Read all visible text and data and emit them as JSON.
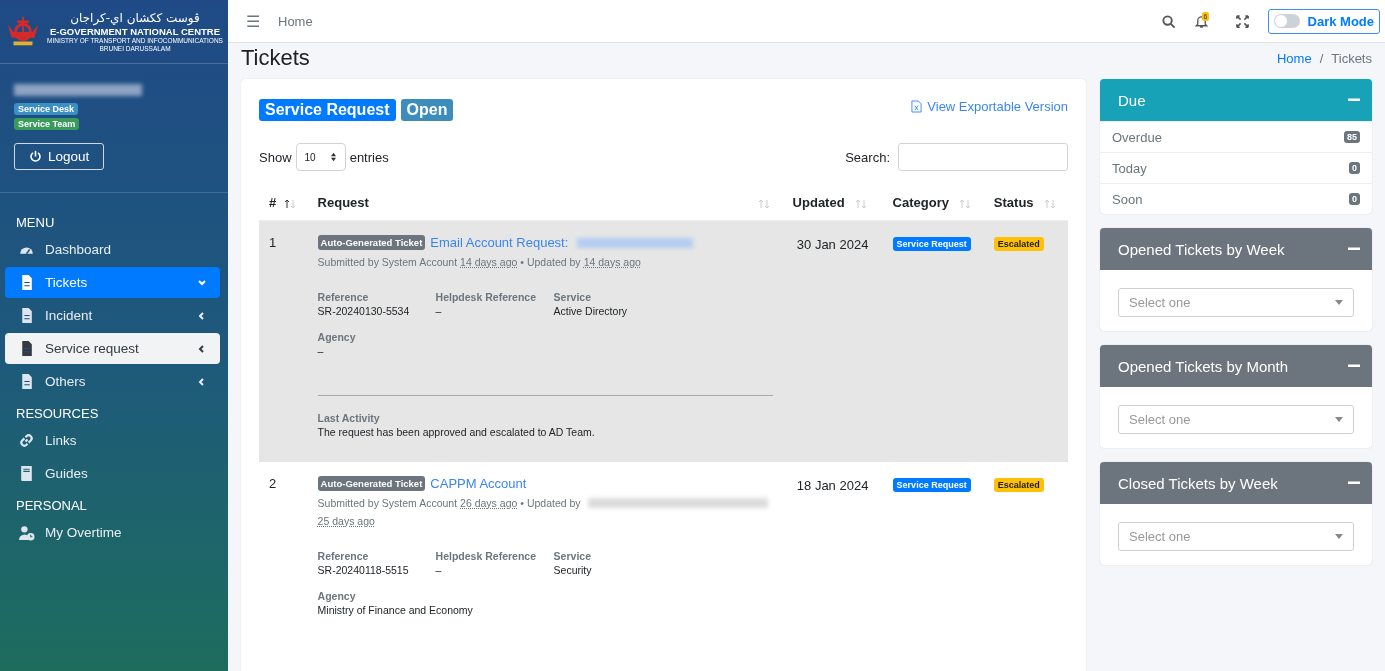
{
  "sidebar": {
    "logo": {
      "jawi": "ڤوست ککشان اي-كراجان",
      "title": "E-GOVERNMENT NATIONAL CENTRE",
      "subtitle": "MINISTRY OF TRANSPORT AND INFOCOMMUNICATIONS",
      "country": "BRUNEI DARUSSALAM"
    },
    "user": {
      "name_blurred": true,
      "roles": [
        {
          "label": "Service Desk",
          "color": "#3a8fc4"
        },
        {
          "label": "Service Team",
          "color": "#3a9a5c"
        }
      ]
    },
    "logout": "Logout",
    "sections": [
      {
        "heading": "MENU",
        "items": [
          {
            "label": "Dashboard",
            "selected": false,
            "highlighted": false
          },
          {
            "label": "Tickets",
            "selected": true,
            "highlighted": false,
            "expanded": true
          },
          {
            "label": "Incident",
            "selected": false,
            "highlighted": false,
            "expanded": false
          },
          {
            "label": "Service request",
            "selected": false,
            "highlighted": true,
            "expanded": false
          },
          {
            "label": "Others",
            "selected": false,
            "highlighted": false,
            "expanded": false
          }
        ]
      },
      {
        "heading": "RESOURCES",
        "items": [
          {
            "label": "Links",
            "selected": false,
            "highlighted": false
          },
          {
            "label": "Guides",
            "selected": false,
            "highlighted": false
          }
        ]
      },
      {
        "heading": "PERSONAL",
        "items": [
          {
            "label": "My Overtime",
            "selected": false,
            "highlighted": false
          }
        ]
      }
    ]
  },
  "topbar": {
    "menu_glyph": "☰",
    "home": "Home",
    "notifications": "6",
    "dark_mode": {
      "label": "Dark Mode",
      "on": false
    }
  },
  "page": {
    "title": "Tickets",
    "breadcrumb_separator": "/",
    "breadcrumb": [
      {
        "label": "Home",
        "link": true
      },
      {
        "label": "Tickets",
        "link": false
      }
    ]
  },
  "tickets": {
    "badges": [
      {
        "label": "Service Request",
        "color": "#007bff"
      },
      {
        "label": "Open",
        "color": "#3c8dbc"
      }
    ],
    "export_link": "View Exportable Version",
    "show": "Show",
    "page_size": "10",
    "entries": "entries",
    "search_label": "Search:",
    "columns": [
      {
        "label": "#",
        "sorted": true
      },
      {
        "label": "Request",
        "sorted": false
      },
      {
        "label": "Updated",
        "sorted": false
      },
      {
        "label": "Category",
        "sorted": false
      },
      {
        "label": "Status",
        "sorted": false
      }
    ],
    "rows": [
      {
        "number": "1",
        "selected": true,
        "tag": "Auto-Generated Ticket",
        "title": "Email Account Request:",
        "title_blurred": true,
        "submitted_by": "Submitted by System Account",
        "submitted_ago": "14 days ago",
        "updated_by": "• Updated by",
        "updater_blurred": false,
        "updated_ago": "14 days ago",
        "updated": "30 Jan 2024",
        "category": "Service Request",
        "status": "Escalated",
        "fields": [
          {
            "label": "Reference",
            "value": "SR-20240130-5534"
          },
          {
            "label": "Helpdesk Reference",
            "value": "–"
          },
          {
            "label": "Service",
            "value": "Active Directory"
          },
          {
            "label": "Agency",
            "value": "–"
          }
        ],
        "last_activity": {
          "label": "Last Activity",
          "text": "The request has been approved and escalated to AD Team."
        }
      },
      {
        "number": "2",
        "selected": false,
        "tag": "Auto-Generated Ticket",
        "title": "CAPPM Account",
        "title_blurred": false,
        "submitted_by": "Submitted by System Account",
        "submitted_ago": "26 days ago",
        "updated_by": "• Updated by",
        "updater_blurred": true,
        "updated_ago": "25 days ago",
        "updated": "18 Jan 2024",
        "category": "Service Request",
        "status": "Escalated",
        "fields": [
          {
            "label": "Reference",
            "value": "SR-20240118-5515"
          },
          {
            "label": "Helpdesk Reference",
            "value": "–"
          },
          {
            "label": "Service",
            "value": "Security"
          },
          {
            "label": "Agency",
            "value": "Ministry of Finance and Economy"
          }
        ]
      }
    ]
  },
  "widgets": {
    "due": {
      "title": "Due",
      "items": [
        {
          "label": "Overdue",
          "count": "85"
        },
        {
          "label": "Today",
          "count": "0"
        },
        {
          "label": "Soon",
          "count": "0"
        }
      ]
    },
    "selects": [
      {
        "title": "Opened Tickets by Week",
        "placeholder": "Select one"
      },
      {
        "title": "Opened Tickets by Month",
        "placeholder": "Select one"
      },
      {
        "title": "Closed Tickets by Week",
        "placeholder": "Select one"
      }
    ]
  }
}
